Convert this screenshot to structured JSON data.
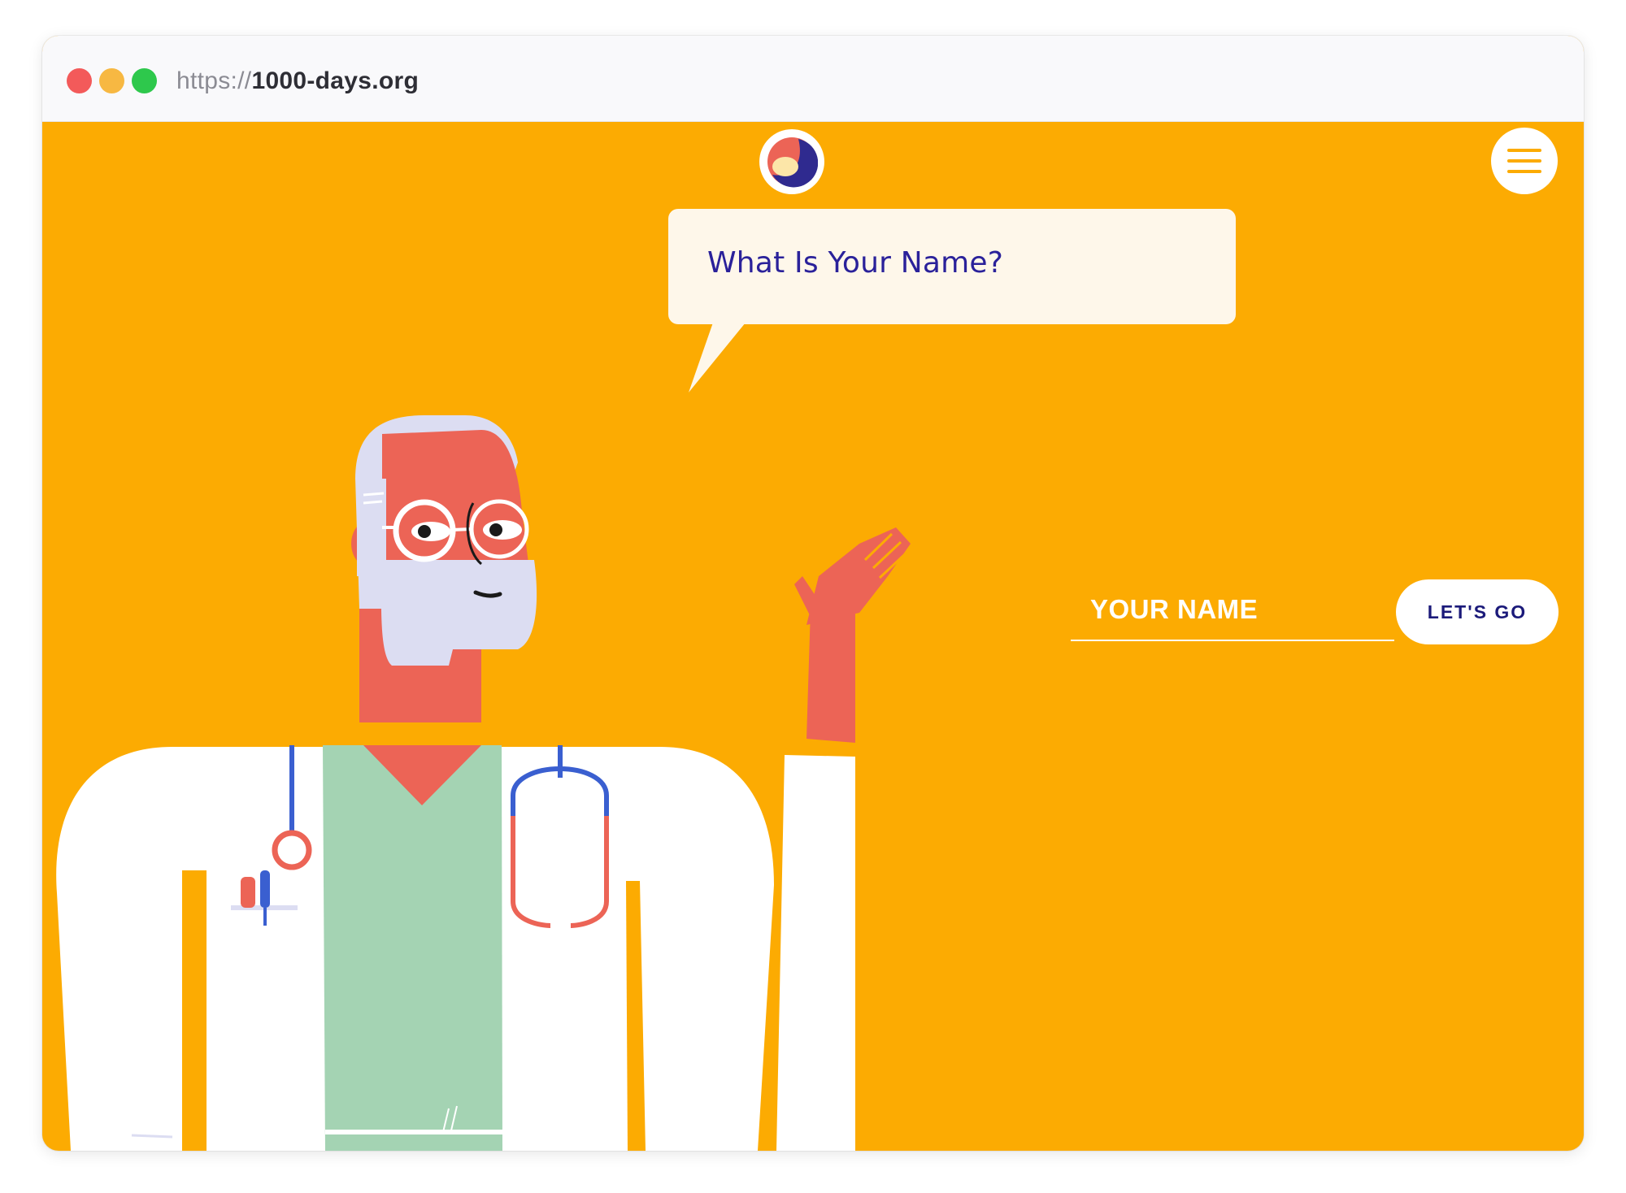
{
  "browser": {
    "url_scheme": "https://",
    "url_host": "1000-days.org"
  },
  "page": {
    "background_color": "#FCAB02",
    "bubble_text": "What Is Your Name?",
    "name_input": {
      "placeholder": "YOUR NAME",
      "value": ""
    },
    "submit_label": "LET'S GO"
  },
  "icons": {
    "logo": "site-logo-icon",
    "menu": "hamburger-menu-icon",
    "illustration": "doctor-illustration"
  },
  "colors": {
    "accent_blue": "#2a219a",
    "coral": "#EC6456",
    "scrubs_green": "#A4D3B3",
    "beard_lavender": "#DCDDF2"
  }
}
